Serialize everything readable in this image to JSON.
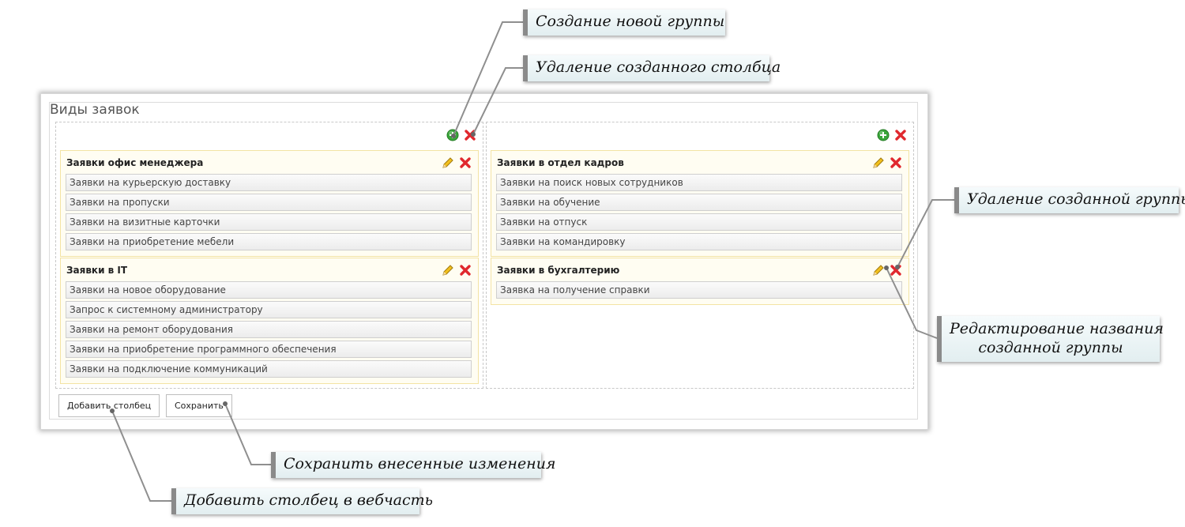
{
  "panel": {
    "title": "Виды заявок"
  },
  "columns": [
    {
      "groups": [
        {
          "title": "Заявки офис менеджера",
          "items": [
            "Заявки на курьерскую доставку",
            "Заявки на пропуски",
            "Заявки на визитные карточки",
            "Заявки на приобретение мебели"
          ]
        },
        {
          "title": "Заявки в IT",
          "items": [
            "Заявки на новое оборудование",
            "Запрос к системному администратору",
            "Заявки на ремонт оборудования",
            "Заявки на приобретение программного обеспечения",
            "Заявки на подключение коммуникаций"
          ]
        }
      ]
    },
    {
      "groups": [
        {
          "title": "Заявки в отдел кадров",
          "items": [
            "Заявки на поиск новых сотрудников",
            "Заявки на обучение",
            "Заявки на отпуск",
            "Заявки на командировку"
          ]
        },
        {
          "title": "Заявки в бухгалтерию",
          "items": [
            "Заявка на получение справки"
          ]
        }
      ]
    }
  ],
  "buttons": {
    "add_column": "Добавить столбец",
    "save": "Сохранить"
  },
  "callouts": {
    "create_group": "Создание новой группы",
    "delete_column": "Удаление созданного столбца",
    "delete_group": "Удаление созданной группы",
    "edit_group_line1": "Редактирование названия",
    "edit_group_line2": "созданной группы",
    "save_changes": "Сохранить внесенные изменения",
    "add_column_webpart": "Добавить столбец в вебчасть"
  },
  "icons": {
    "add": "plus-circle-icon",
    "delete": "red-x-icon",
    "edit": "pencil-icon"
  },
  "colors": {
    "add_green": "#3aa63a",
    "delete_red": "#e0282e",
    "pencil_yellow": "#f2c01d",
    "group_border": "#f3e3a3"
  }
}
